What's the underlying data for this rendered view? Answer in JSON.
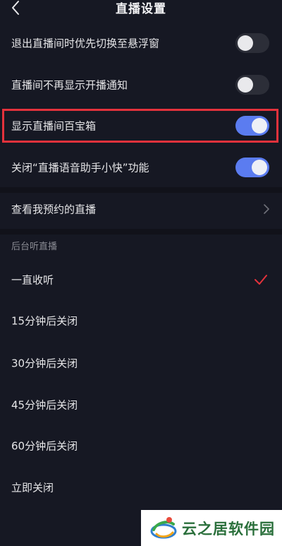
{
  "header": {
    "title": "直播设置"
  },
  "toggles": [
    {
      "label": "退出直播间时优先切换至悬浮窗",
      "state": "off"
    },
    {
      "label": "直播间不再显示开播通知",
      "state": "off"
    },
    {
      "label": "显示直播间百宝箱",
      "state": "on",
      "highlighted": true
    },
    {
      "label": "关闭“直播语音助手小快”功能",
      "state": "on"
    }
  ],
  "nav": {
    "reservations_label": "查看我预约的直播"
  },
  "background_listen": {
    "section_title": "后台听直播",
    "options": [
      {
        "label": "一直收听",
        "selected": true
      },
      {
        "label": "15分钟后关闭",
        "selected": false
      },
      {
        "label": "30分钟后关闭",
        "selected": false
      },
      {
        "label": "45分钟后关闭",
        "selected": false
      },
      {
        "label": "60分钟后关闭",
        "selected": false
      },
      {
        "label": "立即关闭",
        "selected": false
      }
    ]
  },
  "watermark": {
    "text": "云之居软件园"
  },
  "colors": {
    "background": "#161823",
    "toggle_on": "#5b7cf0",
    "toggle_off": "#2c2e38",
    "highlight": "#e4323c",
    "check": "#e4323c"
  }
}
